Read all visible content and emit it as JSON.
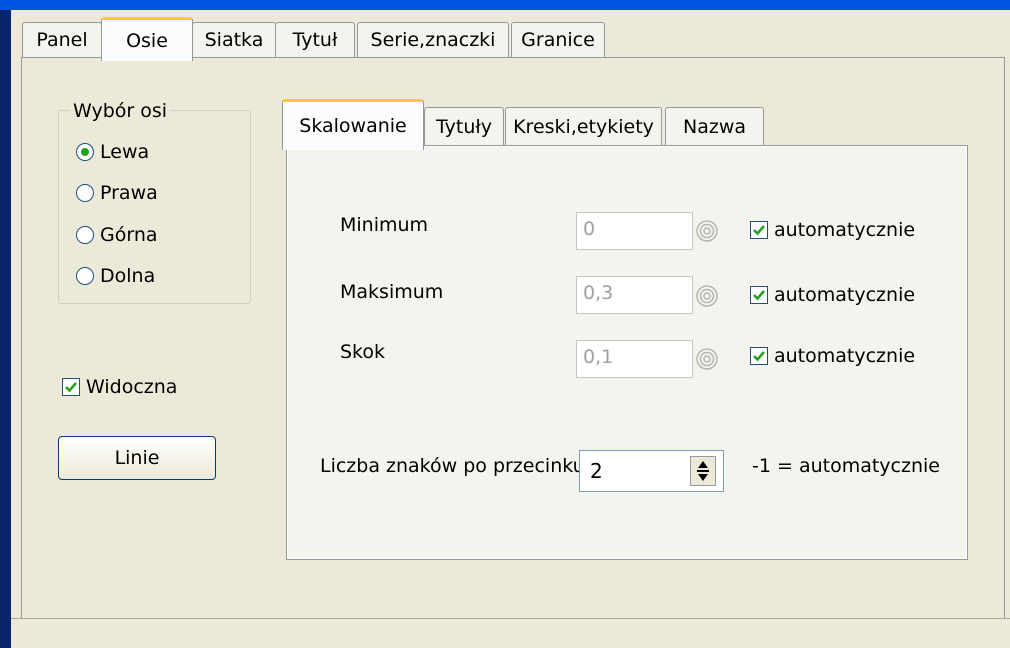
{
  "outer_tabs": [
    {
      "label": "Panel",
      "active": false
    },
    {
      "label": "Osie",
      "active": true
    },
    {
      "label": "Siatka",
      "active": false
    },
    {
      "label": "Tytuł",
      "active": false
    },
    {
      "label": "Serie,znaczki",
      "active": false
    },
    {
      "label": "Granice",
      "active": false
    }
  ],
  "axis_group": {
    "label": "Wybór osi",
    "options": [
      {
        "label": "Lewa",
        "selected": true
      },
      {
        "label": "Prawa",
        "selected": false
      },
      {
        "label": "Górna",
        "selected": false
      },
      {
        "label": "Dolna",
        "selected": false
      }
    ]
  },
  "visible_checkbox": {
    "label": "Widoczna",
    "checked": true
  },
  "lines_button": {
    "label": "Linie"
  },
  "inner_tabs": [
    {
      "label": "Skalowanie",
      "active": true
    },
    {
      "label": "Tytuły",
      "active": false
    },
    {
      "label": "Kreski,etykiety",
      "active": false
    },
    {
      "label": "Nazwa",
      "active": false
    }
  ],
  "scaling": {
    "minimum": {
      "label": "Minimum",
      "value": "0",
      "auto_label": "automatycznie",
      "auto_checked": true
    },
    "maximum": {
      "label": "Maksimum",
      "value": "0,3",
      "auto_label": "automatycznie",
      "auto_checked": true
    },
    "step": {
      "label": "Skok",
      "value": "0,1",
      "auto_label": "automatycznie",
      "auto_checked": true
    }
  },
  "decimals": {
    "label": "Liczba znaków po przecinku",
    "value": "2",
    "hint": "-1 = automatycznie"
  },
  "colors": {
    "active_tab_accent": "#ffc83c",
    "checkmark": "#21a121",
    "window_bg": "#ece9d8"
  }
}
